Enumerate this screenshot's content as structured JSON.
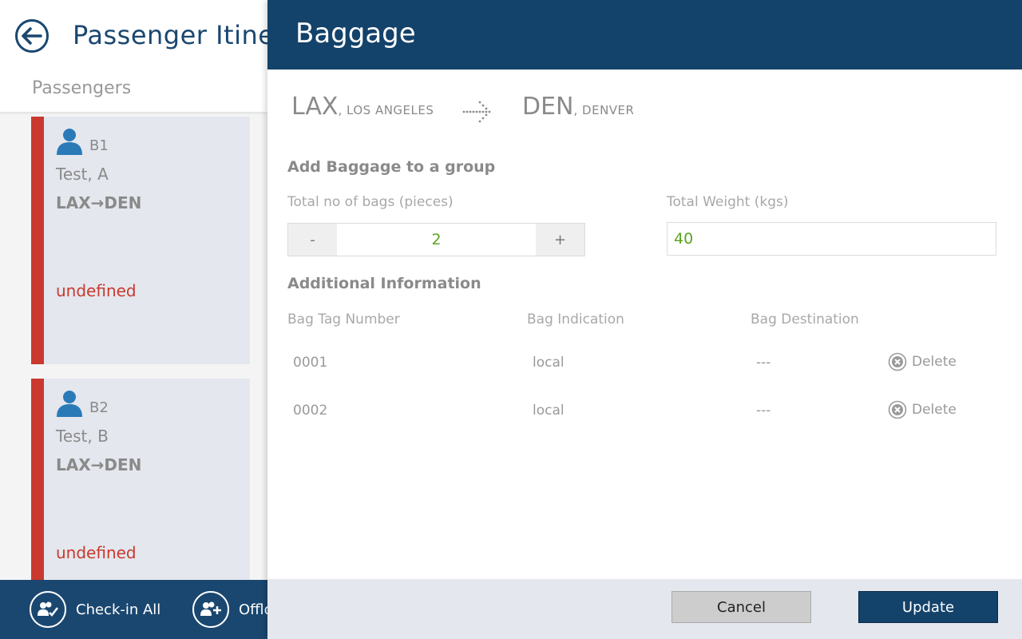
{
  "left_panel": {
    "title": "Passenger Itinerary",
    "section_label": "Passengers",
    "passengers": [
      {
        "id": "B1",
        "name": "Test, A",
        "route": "LAX→DEN",
        "status": "undefined"
      },
      {
        "id": "B2",
        "name": "Test, B",
        "route": "LAX→DEN",
        "status": "undefined"
      }
    ],
    "footer": {
      "checkin_all_label": "Check-in All",
      "offload_label": "Offload"
    }
  },
  "baggage_panel": {
    "title": "Baggage",
    "route": {
      "origin_code": "LAX",
      "origin_city": ", LOS ANGELES",
      "destination_code": "DEN",
      "destination_city": ", DENVER"
    },
    "add_group_heading": "Add Baggage to a group",
    "bags_label": "Total no of bags (pieces)",
    "bags_minus": "-",
    "bags_plus": "+",
    "bags_value": "2",
    "weight_label": "Total Weight (kgs)",
    "weight_value": "40",
    "additional_heading": "Additional Information",
    "columns": [
      "Bag Tag Number",
      "Bag Indication",
      "Bag Destination"
    ],
    "bags": [
      {
        "tag": "0001",
        "indication": "local",
        "destination": "---",
        "delete_label": "Delete"
      },
      {
        "tag": "0002",
        "indication": "local",
        "destination": "---",
        "delete_label": "Delete"
      }
    ],
    "cancel_label": "Cancel",
    "update_label": "Update"
  },
  "colors": {
    "header_blue": "#13426a",
    "status_red": "#c9392e",
    "value_green": "#5aa520"
  }
}
